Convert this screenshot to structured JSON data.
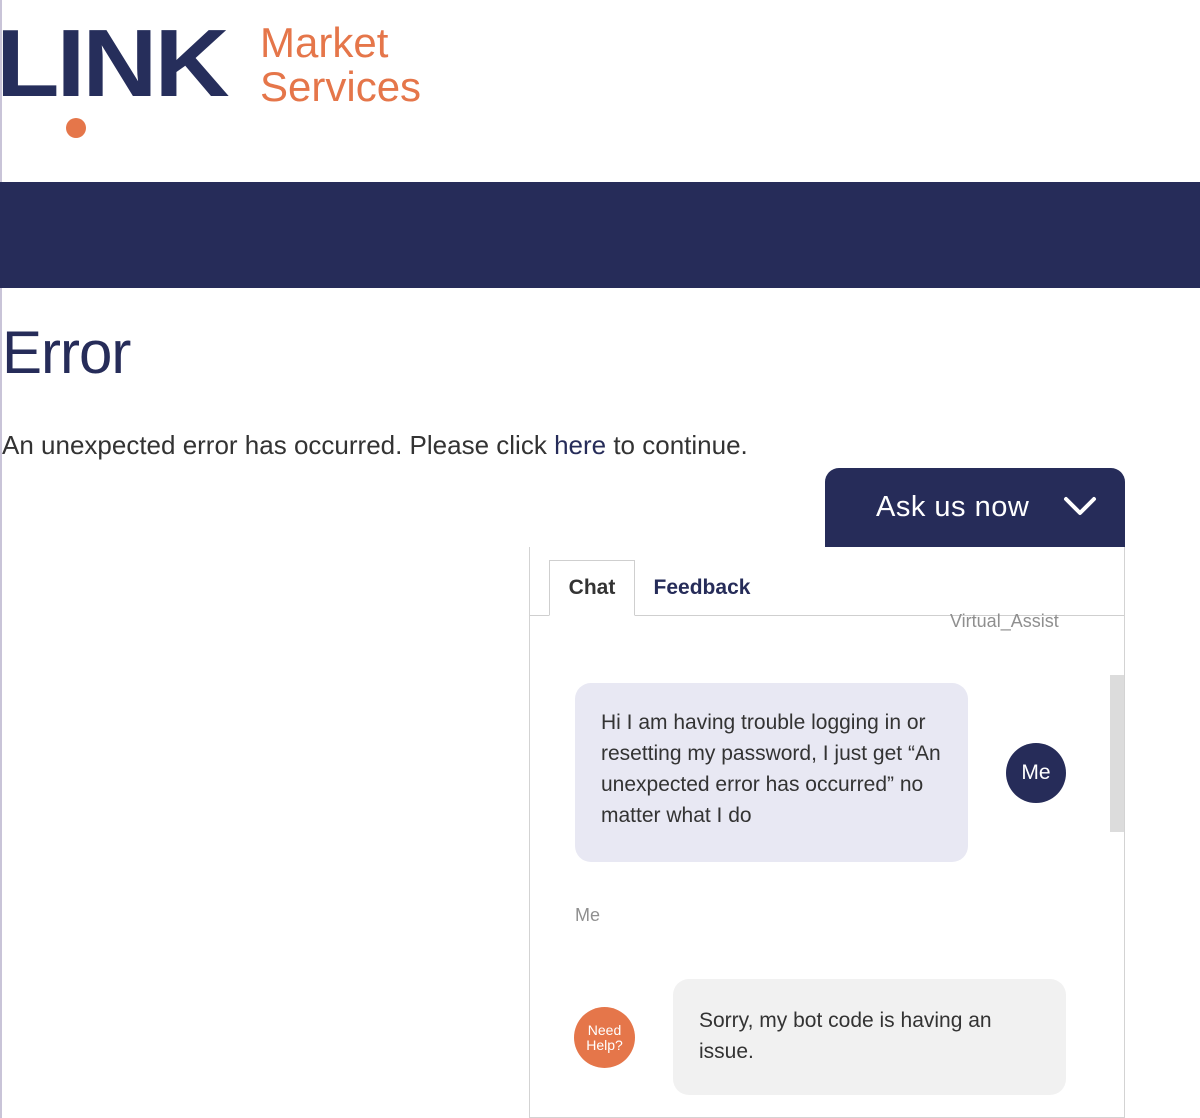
{
  "brand": {
    "name": "LINK",
    "line1": "Market",
    "line2": "Services",
    "navy": "#262c59",
    "orange": "#e5764a"
  },
  "page": {
    "title": "Error",
    "message_before": "An unexpected error has occurred. Please click ",
    "link_text": "here",
    "message_after": " to continue."
  },
  "chat": {
    "header_label": "Ask us now",
    "collapse_icon": "chevron-down-icon",
    "tabs": [
      {
        "label": "Chat",
        "active": true
      },
      {
        "label": "Feedback",
        "active": false
      }
    ],
    "top_sender": "Virtual_Assist",
    "messages": [
      {
        "from": "me",
        "text": "Hi I am having trouble logging in or resetting my password, I just get “An unexpected error has occurred” no matter what I do",
        "avatar_text": "Me",
        "sender_label": "Me"
      },
      {
        "from": "bot",
        "text": "Sorry, my bot code is having an issue.",
        "avatar_line1": "Need",
        "avatar_line2": "Help?"
      }
    ]
  }
}
